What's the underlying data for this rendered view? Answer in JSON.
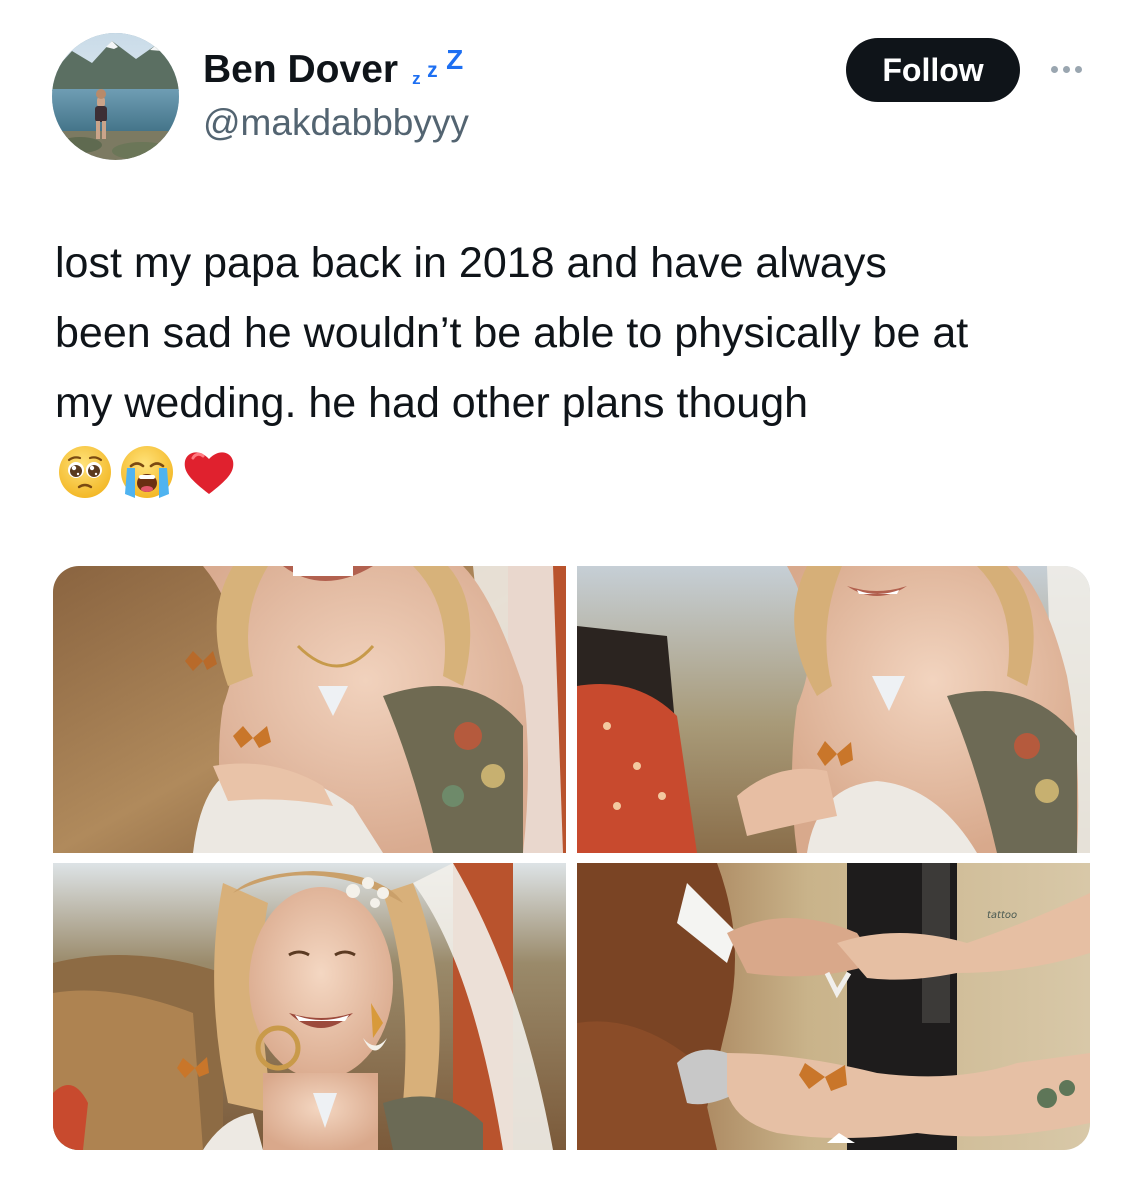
{
  "user": {
    "display_name": "Ben Dover",
    "status_icon": "zzz-sleep-icon",
    "handle": "@makdabbbyyy",
    "avatar_icon": "profile-photo-lake-mountains"
  },
  "actions": {
    "follow_label": "Follow",
    "more_icon": "ellipsis-icon"
  },
  "tweet": {
    "lines": [
      "lost my papa back in 2018 and have always",
      "been sad he wouldn’t be able to physically be at",
      "my wedding. he had other plans though"
    ],
    "emojis": [
      "pleading-face",
      "loudly-crying-face",
      "red-heart"
    ]
  },
  "media": {
    "photos": [
      {
        "name": "bride-butterfly-on-hand-photo"
      },
      {
        "name": "bride-reaching-butterfly-photo"
      },
      {
        "name": "bride-smiling-butterfly-shoulder-photo"
      },
      {
        "name": "holding-hands-butterfly-photo"
      }
    ]
  },
  "colors": {
    "follow_bg": "#0f1419",
    "handle": "#536471",
    "zzz": "#1d6ff2"
  }
}
